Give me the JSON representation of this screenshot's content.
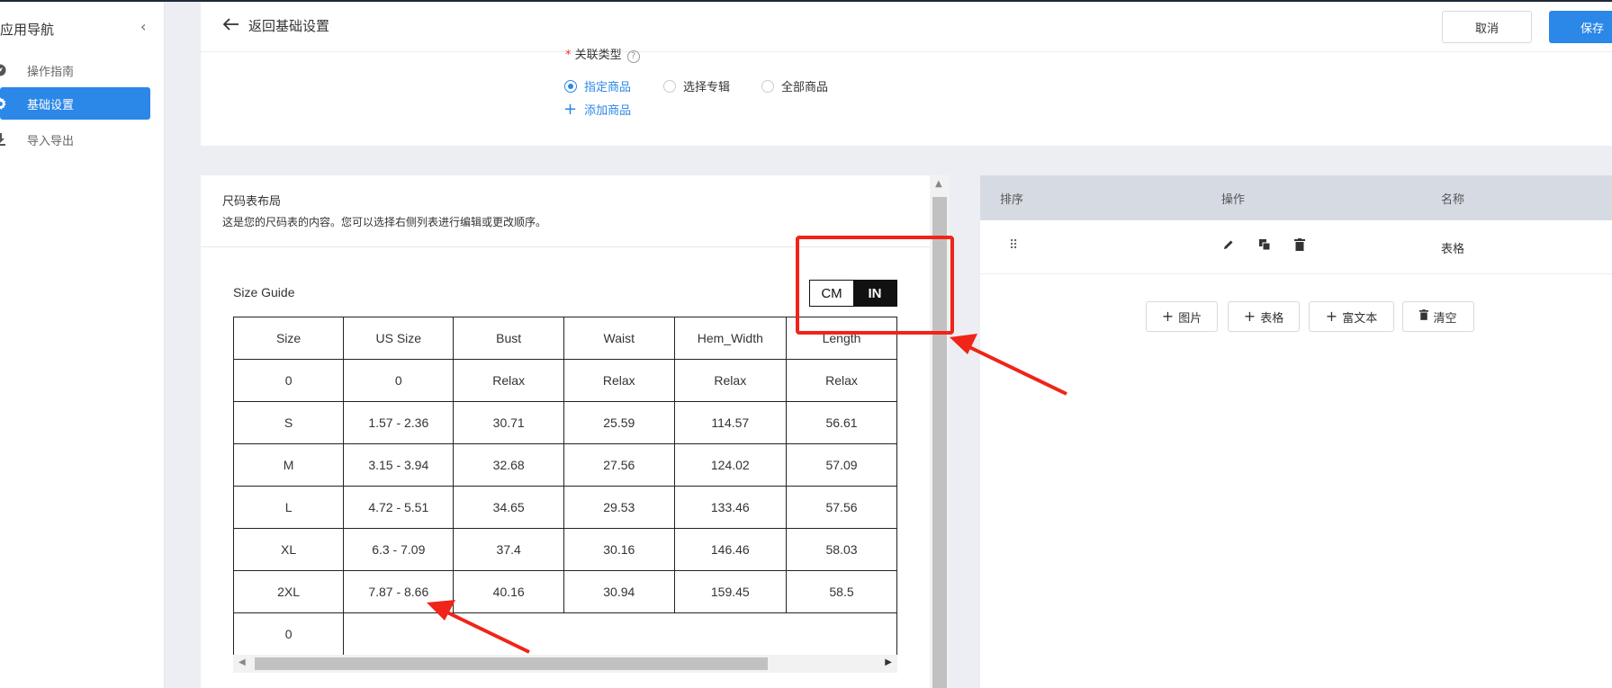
{
  "sidebar": {
    "title": "应用导航",
    "collapse_icon": "‹",
    "items": [
      {
        "label": "操作指南",
        "icon": "compass-icon",
        "active": false
      },
      {
        "label": "基础设置",
        "icon": "gear-icon",
        "active": true
      },
      {
        "label": "导入导出",
        "icon": "download-icon",
        "active": false
      }
    ]
  },
  "header": {
    "back_label": "返回基础设置",
    "cancel_label": "取消",
    "save_label": "保存"
  },
  "association": {
    "label": "关联类型",
    "options": [
      {
        "label": "指定商品",
        "selected": true
      },
      {
        "label": "选择专辑",
        "selected": false
      },
      {
        "label": "全部商品",
        "selected": false
      }
    ],
    "add_product_label": "添加商品"
  },
  "preview": {
    "title": "尺码表布局",
    "description": "这是您的尺码表的内容。您可以选择右侧列表进行编辑或更改顺序。",
    "size_guide_title": "Size Guide",
    "unit_toggle": {
      "cm": "CM",
      "in": "IN",
      "selected": "IN"
    },
    "table": {
      "headers": [
        "Size",
        "US Size",
        "Bust",
        "Waist",
        "Hem_Width",
        "Length"
      ],
      "rows": [
        [
          "0",
          "0",
          "Relax",
          "Relax",
          "Relax",
          "Relax"
        ],
        [
          "S",
          "1.57 - 2.36",
          "30.71",
          "25.59",
          "114.57",
          "56.61"
        ],
        [
          "M",
          "3.15 - 3.94",
          "32.68",
          "27.56",
          "124.02",
          "57.09"
        ],
        [
          "L",
          "4.72 - 5.51",
          "34.65",
          "29.53",
          "133.46",
          "57.56"
        ],
        [
          "XL",
          "6.3 - 7.09",
          "37.4",
          "30.16",
          "146.46",
          "58.03"
        ],
        [
          "2XL",
          "7.87 - 8.66",
          "40.16",
          "30.94",
          "159.45",
          "58.5"
        ],
        [
          "0",
          "",
          "",
          "",
          "",
          ""
        ]
      ]
    }
  },
  "list_panel": {
    "headers": {
      "order": "排序",
      "actions": "操作",
      "name": "名称"
    },
    "rows": [
      {
        "name": "表格",
        "action_icons": [
          "pencil-icon",
          "copy-icon",
          "trash-icon"
        ]
      }
    ],
    "buttons": [
      {
        "label": "图片",
        "icon": "plus-icon"
      },
      {
        "label": "表格",
        "icon": "plus-icon"
      },
      {
        "label": "富文本",
        "icon": "plus-icon"
      },
      {
        "label": "清空",
        "icon": "trash-icon"
      }
    ]
  },
  "colors": {
    "primary": "#2b87e8",
    "annotation": "#f02418",
    "toggle_active": "#111111"
  }
}
